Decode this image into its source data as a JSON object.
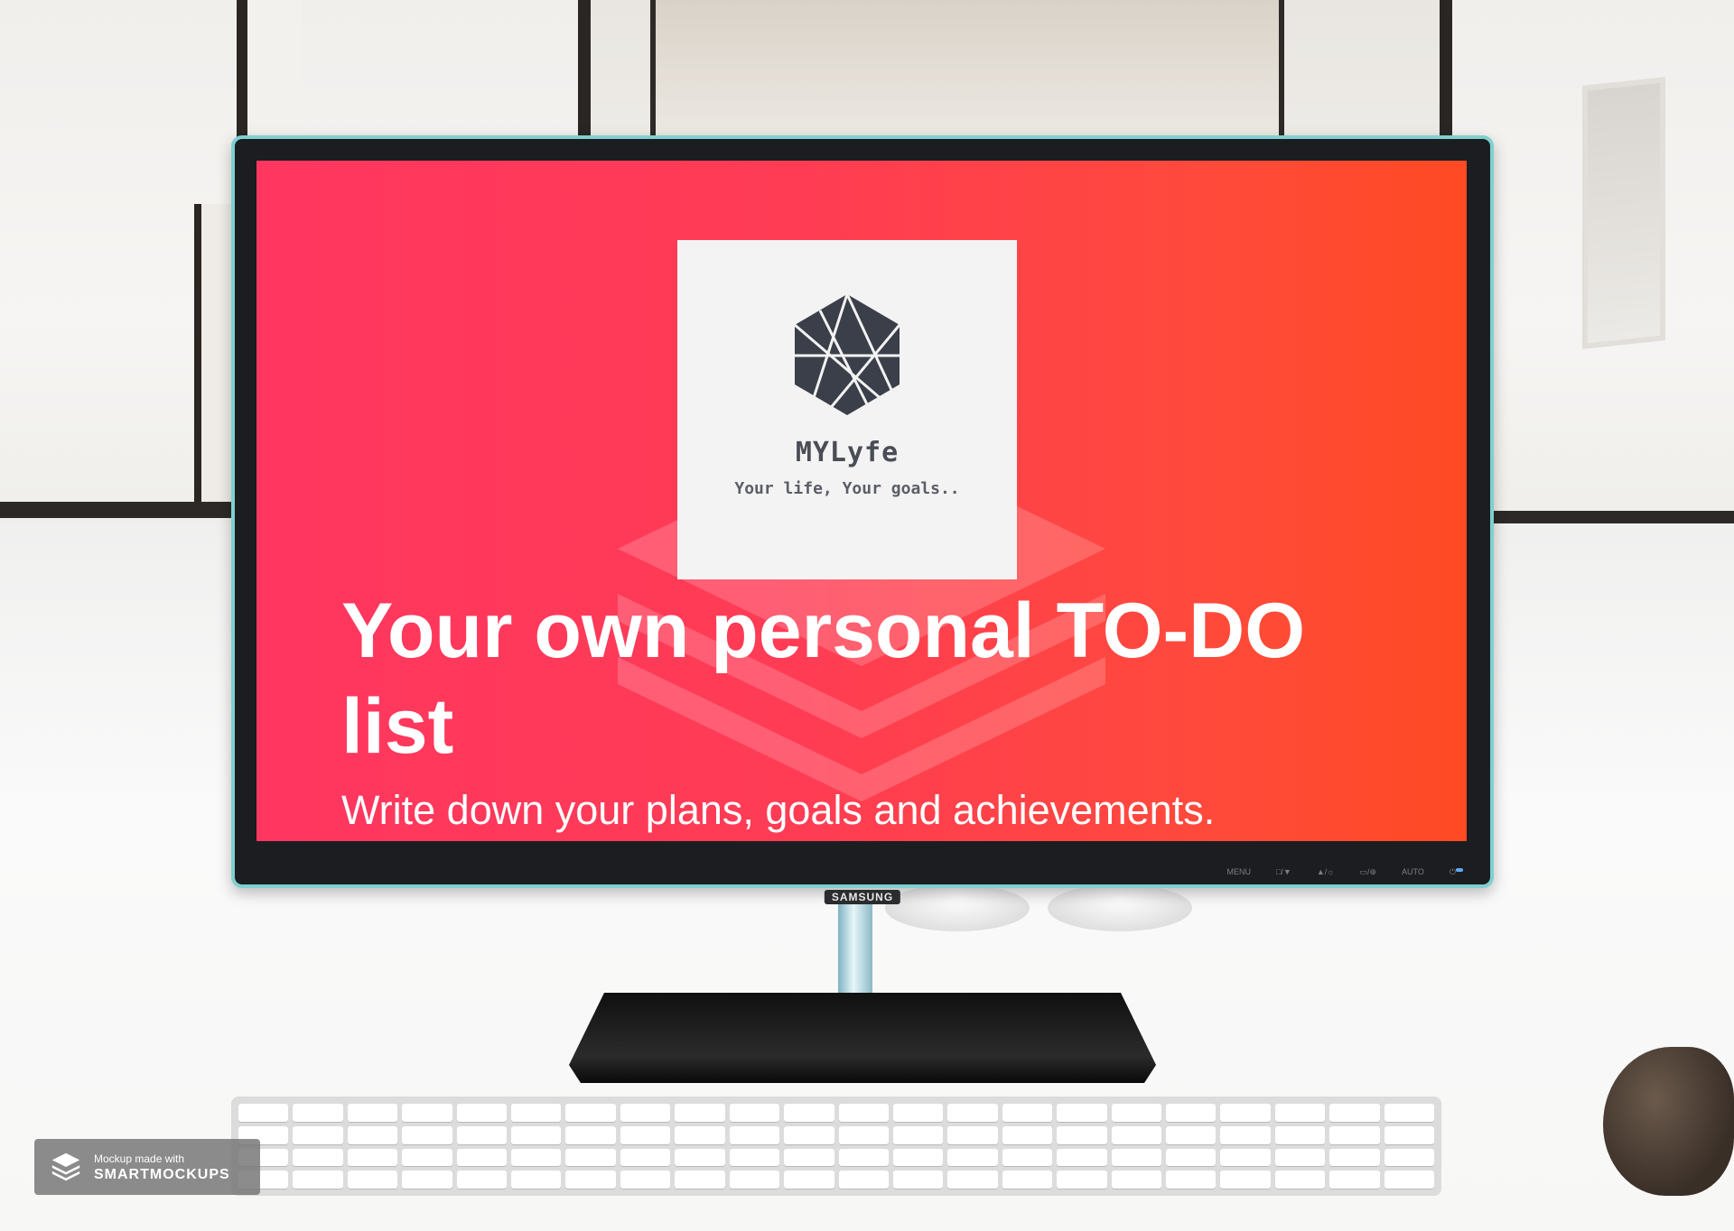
{
  "screen": {
    "logo": {
      "icon": "hexagon-logo-icon",
      "name": "MYLyfe",
      "tagline": "Your life, Your goals.."
    },
    "headline": "Your own personal TO-DO list",
    "subline": "Write down your plans, goals and achievements.",
    "gradient": [
      "#ff3660",
      "#ff4a24"
    ]
  },
  "monitor": {
    "brand": "SAMSUNG",
    "controls": [
      "MENU",
      "□/▼",
      "▲/☼",
      "▭/⊕",
      "AUTO",
      "⏻"
    ]
  },
  "badge": {
    "line1": "Mockup made with",
    "line2": "SMARTMOCKUPS",
    "icon": "layers-icon"
  },
  "colors": {
    "accent": "#ff3c54",
    "logo_dark": "#3a3f4a",
    "bezel_trim": "#7fd0d0"
  }
}
